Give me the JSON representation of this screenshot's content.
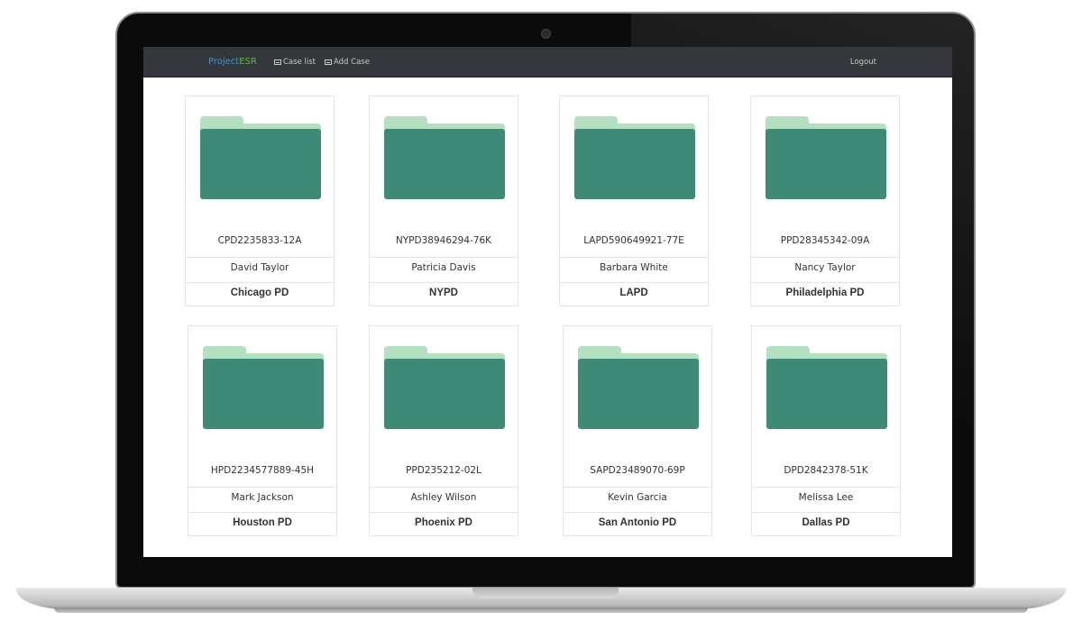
{
  "navbar": {
    "brand_primary": "Project",
    "brand_accent": "ESR",
    "case_list_label": "Case list",
    "add_case_label": "Add Case",
    "logout_label": "Logout"
  },
  "cases": [
    {
      "case_id": "CPD2235833-12A",
      "officer": "David Taylor",
      "department": "Chicago PD"
    },
    {
      "case_id": "NYPD38946294-76K",
      "officer": "Patricia Davis",
      "department": "NYPD"
    },
    {
      "case_id": "LAPD590649921-77E",
      "officer": "Barbara White",
      "department": "LAPD"
    },
    {
      "case_id": "PPD28345342-09A",
      "officer": "Nancy Taylor",
      "department": "Philadelphia PD"
    },
    {
      "case_id": "HPD2234577889-45H",
      "officer": "Mark Jackson",
      "department": "Houston PD"
    },
    {
      "case_id": "PPD235212-02L",
      "officer": "Ashley Wilson",
      "department": "Phoenix PD"
    },
    {
      "case_id": "SAPD23489070-69P",
      "officer": "Kevin Garcia",
      "department": "San Antonio PD"
    },
    {
      "case_id": "DPD2842378-51K",
      "officer": "Melissa Lee",
      "department": "Dallas PD"
    }
  ],
  "colors": {
    "navbar_bg": "#34383c",
    "brand_blue": "#4a90c8",
    "brand_green": "#6ab04c",
    "folder_dark": "#3d8b76",
    "folder_light": "#b3e0bf"
  }
}
